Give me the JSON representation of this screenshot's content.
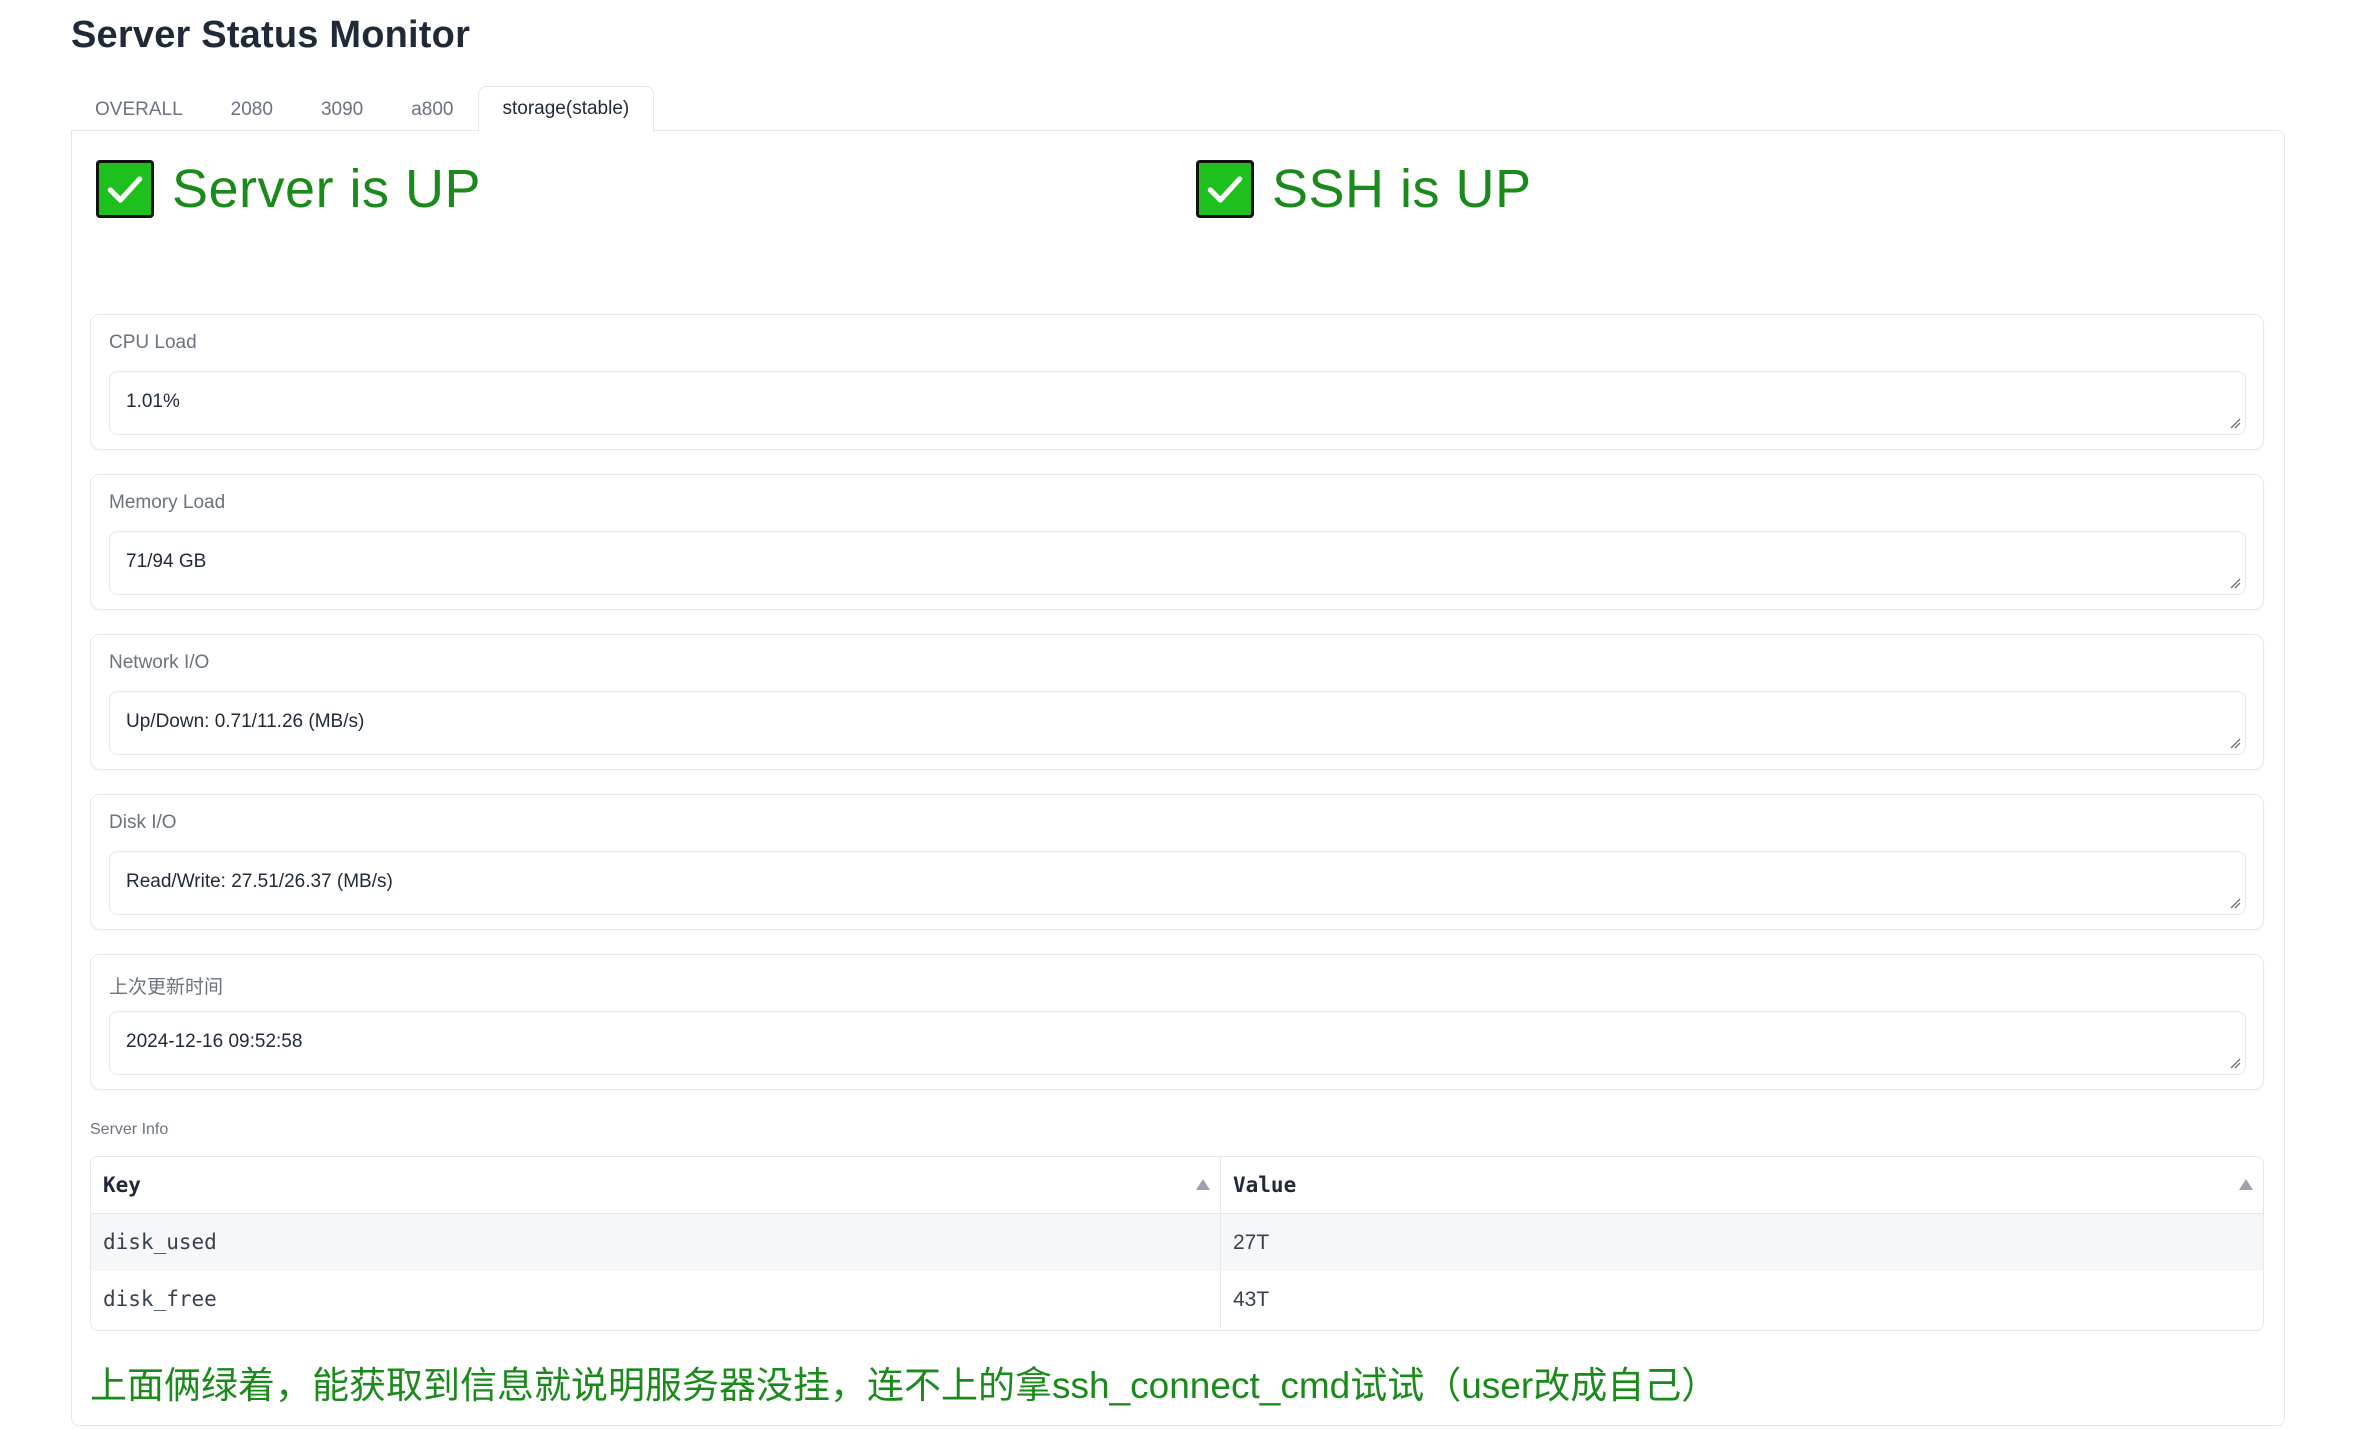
{
  "page_title": "Server Status Monitor",
  "tabs": [
    {
      "label": "OVERALL",
      "active": false
    },
    {
      "label": "2080",
      "active": false
    },
    {
      "label": "3090",
      "active": false
    },
    {
      "label": "a800",
      "active": false
    },
    {
      "label": "storage(stable)",
      "active": true
    }
  ],
  "status": {
    "server": {
      "text": "Server is UP",
      "icon": "check-box-icon",
      "color": "#1a8a1a"
    },
    "ssh": {
      "text": "SSH is UP",
      "icon": "check-box-icon",
      "color": "#1a8a1a"
    }
  },
  "fields": [
    {
      "label": "CPU Load",
      "value": "1.01%"
    },
    {
      "label": "Memory Load",
      "value": "71/94 GB"
    },
    {
      "label": "Network I/O",
      "value": "Up/Down: 0.71/11.26 (MB/s)"
    },
    {
      "label": "Disk I/O",
      "value": "Read/Write: 27.51/26.37 (MB/s)"
    },
    {
      "label": "上次更新时间",
      "value": "2024-12-16 09:52:58"
    }
  ],
  "server_info": {
    "caption": "Server Info",
    "columns": [
      "Key",
      "Value"
    ],
    "rows": [
      [
        "disk_used",
        "27T"
      ],
      [
        "disk_free",
        "43T"
      ]
    ]
  },
  "note": "上面俩绿着，能获取到信息就说明服务器没挂，连不上的拿ssh_connect_cmd试试（user改成自己）",
  "colors": {
    "accent_green": "#1a8a1a",
    "check_fill": "#1ec01e",
    "border": "#e5e7eb"
  }
}
